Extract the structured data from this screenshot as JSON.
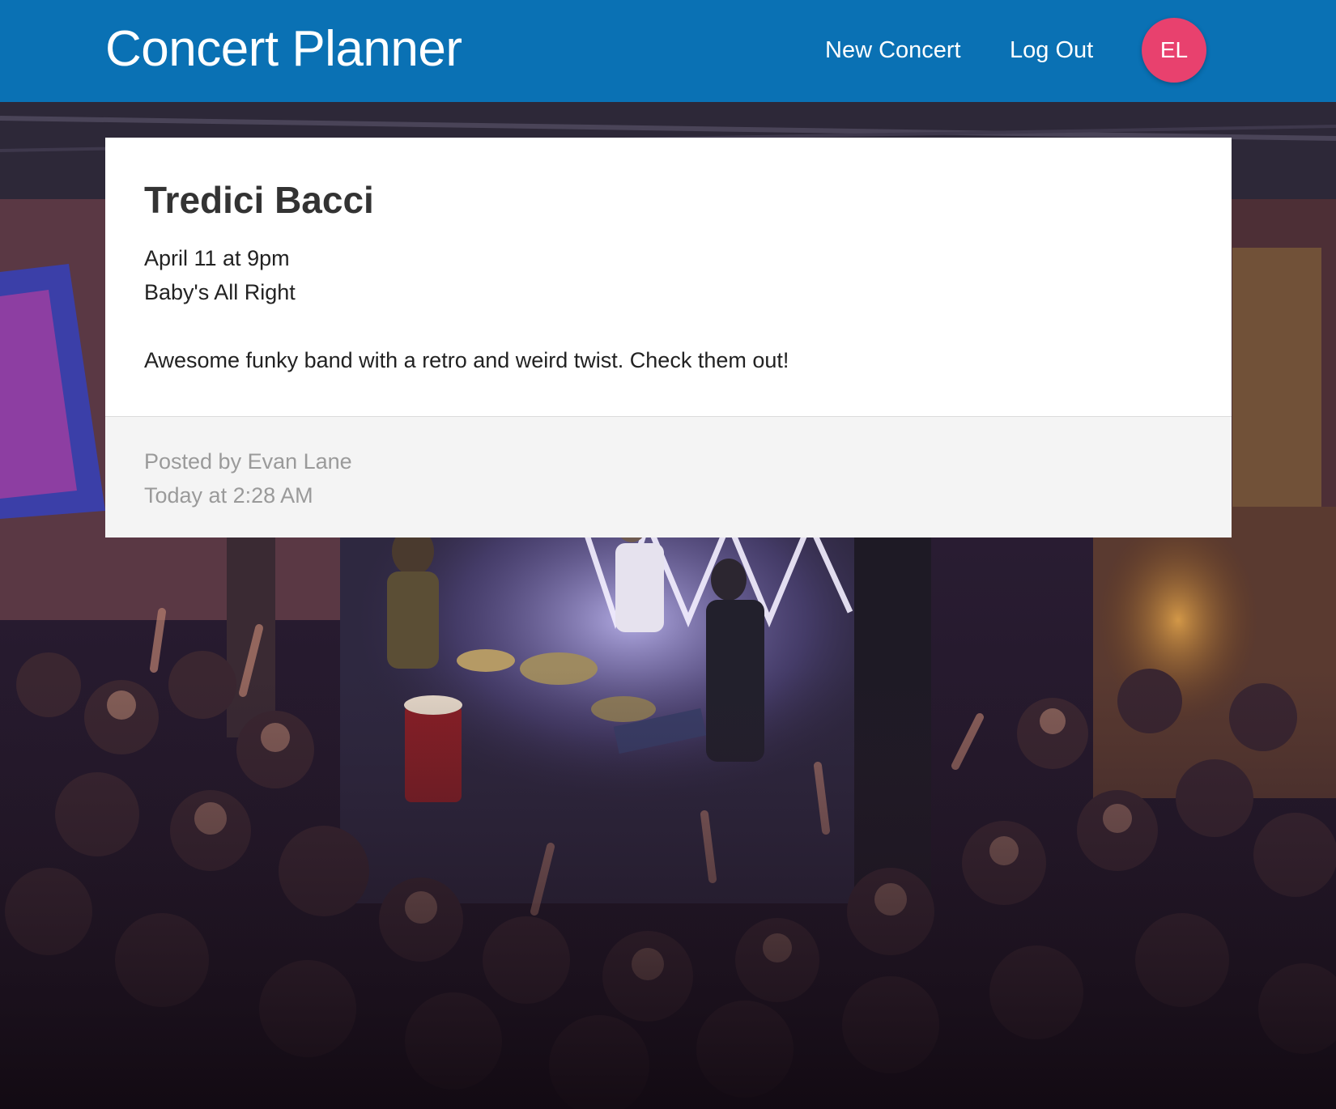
{
  "header": {
    "brand": "Concert Planner",
    "nav": {
      "new_concert": "New Concert",
      "log_out": "Log Out"
    },
    "avatar_initials": "EL"
  },
  "concert": {
    "title": "Tredici Bacci",
    "date": "April 11 at 9pm",
    "venue": "Baby's All Right",
    "description": "Awesome funky band with a retro and weird twist. Check them out!",
    "posted_by": "Posted by Evan Lane",
    "posted_at": "Today at 2:28 AM"
  },
  "colors": {
    "header_bg": "#0a71b4",
    "avatar_bg": "#e8416e",
    "card_bg": "#ffffff",
    "footer_bg": "#f4f4f4",
    "meta_text": "#9a9a9a"
  },
  "background_image": "concert-crowd-photo"
}
